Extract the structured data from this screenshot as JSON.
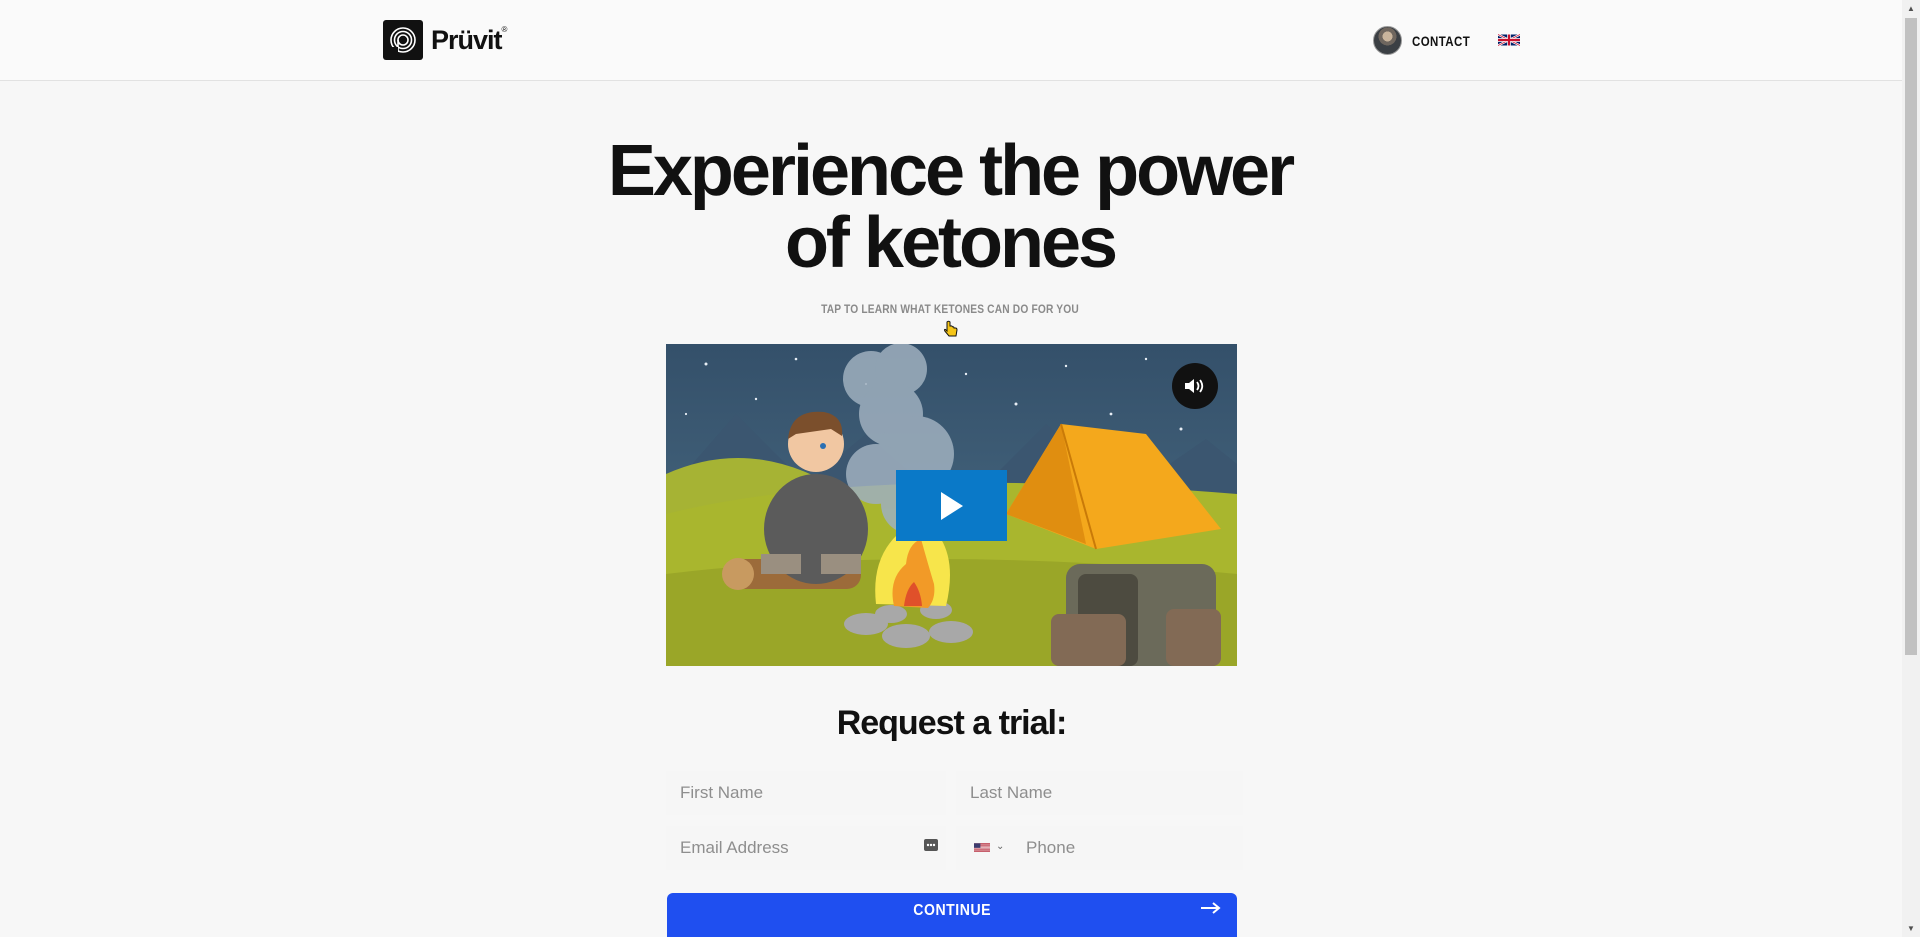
{
  "header": {
    "brand": "Prüvit",
    "brand_mark": "®",
    "contact_label": "CONTACT",
    "language_flag": "uk-flag-icon"
  },
  "hero": {
    "title_line1": "Experience the power",
    "title_line2": "of ketones",
    "subtitle": "TAP TO LEARN WHAT KETONES CAN DO FOR YOU"
  },
  "video": {
    "mute_icon": "speaker-icon",
    "play_icon": "play-icon"
  },
  "form": {
    "title": "Request a trial:",
    "first_name_placeholder": "First Name",
    "last_name_placeholder": "Last Name",
    "email_placeholder": "Email Address",
    "phone_placeholder": "Phone",
    "phone_country_flag": "us-flag-icon",
    "continue_label": "CONTINUE"
  },
  "colors": {
    "primary": "#1f4ff0",
    "play_button": "#0a79c8",
    "text": "#111111",
    "subtitle": "#8a8a8a"
  }
}
